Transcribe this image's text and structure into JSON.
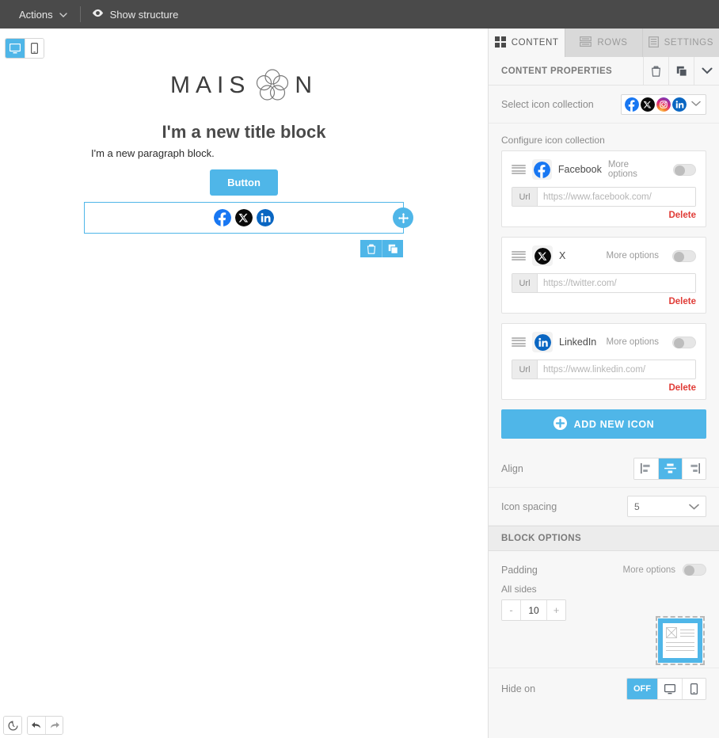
{
  "topbar": {
    "actions_label": "Actions",
    "caret_icon": "chevron-down-icon",
    "eye_icon": "eye-icon",
    "show_structure_label": "Show structure"
  },
  "canvas": {
    "device_toggle": {
      "desktop_icon": "desktop-icon",
      "mobile_icon": "mobile-icon",
      "active": "desktop"
    },
    "logo_text_left": "MAIS",
    "logo_text_right": "N",
    "logo_flower_icon": "flower-logo-icon",
    "title_block": "I'm a new title block",
    "paragraph_block": "I'm a new paragraph block.",
    "button_label": "Button",
    "social_icons": [
      {
        "name": "facebook-icon",
        "color": "#1877F2"
      },
      {
        "name": "x-icon",
        "color": "#000000"
      },
      {
        "name": "linkedin-icon",
        "color": "#0A66C2"
      }
    ],
    "drag_handle_icon": "move-icon",
    "block_tools": [
      {
        "name": "delete-block-button",
        "icon": "trash-icon"
      },
      {
        "name": "duplicate-block-button",
        "icon": "copy-icon"
      }
    ],
    "bottom_tools": [
      {
        "name": "history-button",
        "icon": "history-icon"
      },
      {
        "name": "undo-button",
        "icon": "undo-arrow-icon"
      },
      {
        "name": "redo-button",
        "icon": "redo-arrow-icon"
      }
    ]
  },
  "panel": {
    "tabs": [
      {
        "label": "CONTENT",
        "icon": "grid-icon",
        "active": true
      },
      {
        "label": "ROWS",
        "icon": "rows-icon",
        "active": false
      },
      {
        "label": "SETTINGS",
        "icon": "document-icon",
        "active": false
      }
    ],
    "properties_header": {
      "title": "CONTENT PROPERTIES",
      "delete_icon": "trash-icon",
      "duplicate_icon": "copy-icon",
      "collapse_icon": "chevron-down-icon"
    },
    "select_collection": {
      "label": "Select icon collection",
      "value_icons": [
        "facebook-icon",
        "x-icon",
        "instagram-icon",
        "linkedin-icon"
      ],
      "caret_icon": "chevron-down-icon"
    },
    "configure_label": "Configure icon collection",
    "url_field_tag": "Url",
    "more_options_label": "More options",
    "delete_label": "Delete",
    "icons": [
      {
        "name": "Facebook",
        "icon": "facebook-icon",
        "url_value": "",
        "url_placeholder": "https://www.facebook.com/",
        "more_options_on": false
      },
      {
        "name": "X",
        "icon": "x-icon",
        "url_value": "",
        "url_placeholder": "https://twitter.com/",
        "more_options_on": false
      },
      {
        "name": "LinkedIn",
        "icon": "linkedin-icon",
        "url_value": "",
        "url_placeholder": "https://www.linkedin.com/",
        "more_options_on": false
      }
    ],
    "add_new_icon_label": "ADD NEW ICON",
    "add_new_icon_glyph": "plus-circle-icon",
    "align": {
      "label": "Align",
      "options": [
        "align-left-icon",
        "align-center-icon",
        "align-right-icon"
      ],
      "selected": "align-center-icon"
    },
    "icon_spacing": {
      "label": "Icon spacing",
      "value": "5",
      "caret_icon": "chevron-down-icon"
    },
    "block_options_header": "BLOCK OPTIONS",
    "padding": {
      "label": "Padding",
      "more_options_label": "More options",
      "more_options_on": false,
      "all_sides_label": "All sides",
      "minus_label": "-",
      "value": "10",
      "plus_label": "+",
      "preview_icon": "padding-preview-icon"
    },
    "hide_on": {
      "label": "Hide on",
      "off_label": "OFF",
      "desktop_icon": "desktop-icon",
      "mobile_icon": "mobile-icon",
      "active": "off"
    }
  },
  "colors": {
    "accent": "#4fb6e8",
    "topbar": "#4a4a4a",
    "panel_bg": "#f7f7f7",
    "danger": "#e03b36"
  }
}
